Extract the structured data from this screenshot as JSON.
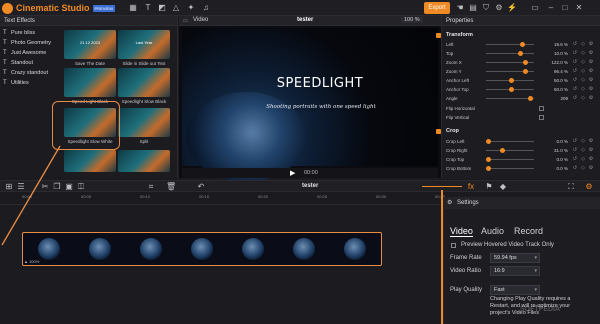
{
  "app": {
    "name": "Cinematic Studio",
    "badge": "PREVIEW",
    "export_label": "Export"
  },
  "top_tabs": [
    "Text Effects",
    "Video",
    "tester",
    "100 %",
    "Properties"
  ],
  "left": {
    "categories": [
      "Pure bliss",
      "Photo Geometry",
      "Just Awesome",
      "Standout",
      "Crazy standout",
      "Utilities"
    ],
    "thumbs": [
      {
        "label": "Save The Date",
        "caption": "21 12 2023"
      },
      {
        "label": "Slide in Slide out Text",
        "caption": "Last Year"
      },
      {
        "label": "Speed Light Black",
        "caption": ""
      },
      {
        "label": "Speedlight Slow Black",
        "caption": ""
      },
      {
        "label": "Speedlight Slow White",
        "caption": ""
      },
      {
        "label": "Split",
        "caption": ""
      },
      {
        "label": "",
        "caption": ""
      },
      {
        "label": "",
        "caption": ""
      }
    ]
  },
  "preview": {
    "title": "SPEEDLIGHT",
    "subtitle": "Shooting portraits with one speed light",
    "time": "00:00"
  },
  "properties": {
    "transform_title": "Transform",
    "transform": [
      {
        "label": "Left",
        "value": "19.6 %",
        "fraction": 0.73
      },
      {
        "label": "Top",
        "value": "10.0 %",
        "fraction": 0.7
      },
      {
        "label": "Zoom X",
        "value": "122.0 %",
        "fraction": 0.8
      },
      {
        "label": "Zoom Y",
        "value": "96.4 %",
        "fraction": 0.8
      },
      {
        "label": "Anchor Left",
        "value": "50.0 %",
        "fraction": 0.5
      },
      {
        "label": "Anchor Top",
        "value": "50.0 %",
        "fraction": 0.5
      },
      {
        "label": "Angle",
        "value": "209",
        "fraction": 0.92
      }
    ],
    "flips": [
      "Flip Horizontal",
      "Flip Vertical"
    ],
    "crop_title": "Crop",
    "crop": [
      {
        "label": "Crop Left",
        "value": "0.0 %",
        "fraction": 0.0
      },
      {
        "label": "Crop Right",
        "value": "31.0 %",
        "fraction": 0.3
      },
      {
        "label": "Crop Top",
        "value": "0.0 %",
        "fraction": 0.0
      },
      {
        "label": "Crop Bottom",
        "value": "0.0 %",
        "fraction": 0.0
      }
    ]
  },
  "timeline": {
    "title": "tester",
    "ticks": [
      "00:00",
      "00:05",
      "00:10",
      "00:15",
      "00:20",
      "00:25",
      "00:30",
      "00:35"
    ],
    "clip_zoom": "100%"
  },
  "settings": {
    "title": "Settings",
    "tabs": [
      "Video",
      "Audio",
      "Record"
    ],
    "preview_hover": "Preview Hovered Video Track Only",
    "frame_rate_label": "Frame Rate",
    "frame_rate": "59.94 fps",
    "ratio_label": "Video Ratio",
    "ratio": "16:9",
    "play_quality_label": "Play Quality",
    "play_quality": "Fast",
    "note": "Changing Play Quality requires a Restart, and will re-optimize your project's Video Files"
  },
  "watermark": "SOFTPEDIA"
}
